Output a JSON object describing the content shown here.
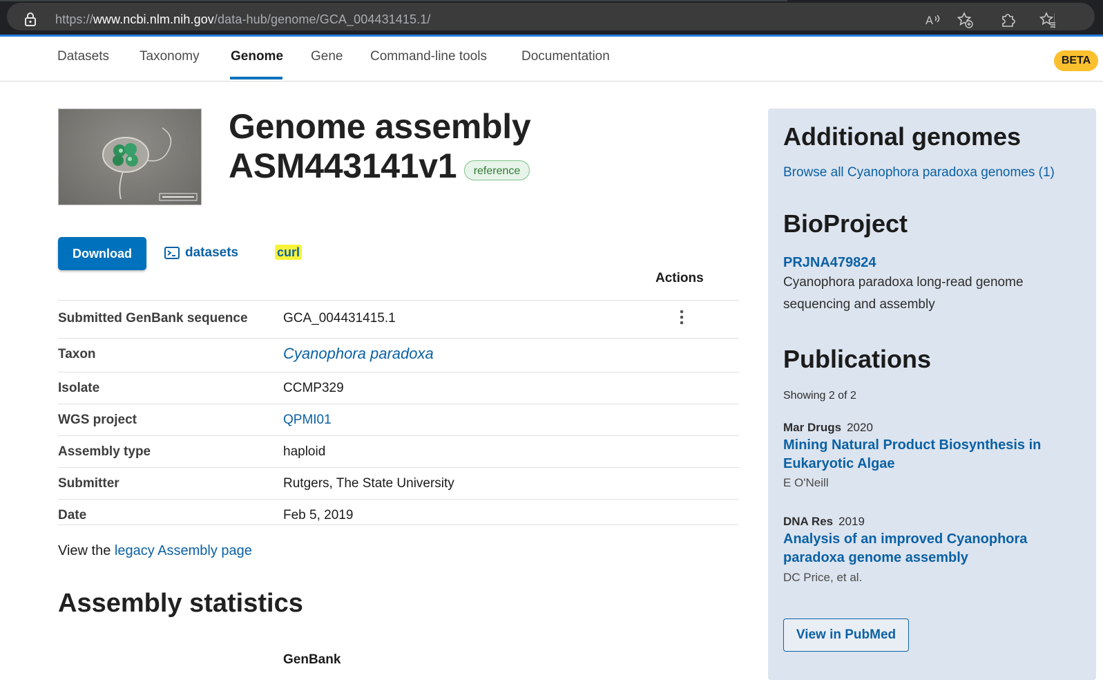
{
  "browser": {
    "url_prefix": "https://",
    "url_host": "www.ncbi.nlm.nih.gov",
    "url_path": "/data-hub/genome/GCA_004431415.1/",
    "icons": [
      "lock-icon",
      "read-aloud-icon",
      "favorite-add-icon",
      "extensions-icon",
      "favorites-icon"
    ]
  },
  "nav": {
    "items": [
      "Datasets",
      "Taxonomy",
      "Genome",
      "Gene",
      "Command-line tools",
      "Documentation"
    ],
    "active": "Genome",
    "beta": "BETA"
  },
  "header": {
    "title_line1": "Genome assembly",
    "title_line2": "ASM443141v1",
    "badge": "reference"
  },
  "actions": {
    "download": "Download",
    "datasets": "datasets",
    "curl": "curl",
    "actions_label": "Actions"
  },
  "details": [
    {
      "key": "Submitted GenBank sequence",
      "value": "GCA_004431415.1"
    },
    {
      "key": "Taxon",
      "value": "Cyanophora paradoxa"
    },
    {
      "key": "Isolate",
      "value": "CCMP329"
    },
    {
      "key": "WGS project",
      "value": "QPMI01"
    },
    {
      "key": "Assembly type",
      "value": "haploid"
    },
    {
      "key": "Submitter",
      "value": "Rutgers, The State University"
    },
    {
      "key": "Date",
      "value": "Feb 5, 2019"
    }
  ],
  "legacy": {
    "prefix": "View the ",
    "link": "legacy Assembly page"
  },
  "stats": {
    "title": "Assembly statistics",
    "column": "GenBank"
  },
  "sidebar": {
    "additional_title": "Additional genomes",
    "browse_link": "Browse all Cyanophora paradoxa genomes (1)",
    "bioproject_title": "BioProject",
    "bioproject_id": "PRJNA479824",
    "bioproject_desc": "Cyanophora paradoxa long-read genome sequencing and assembly",
    "publications_title": "Publications",
    "showing": "Showing 2 of 2",
    "publications": [
      {
        "journal": "Mar Drugs",
        "year": "2020",
        "title": "Mining Natural Product Biosynthesis in Eukaryotic Algae",
        "authors": "E O'Neill"
      },
      {
        "journal": "DNA Res",
        "year": "2019",
        "title": "Analysis of an improved Cyanophora paradoxa genome assembly",
        "authors": "DC Price, et al."
      }
    ],
    "pubmed_button": "View in PubMed"
  },
  "colors": {
    "accent": "#0071bc",
    "link": "#0b61a4",
    "sidebar_bg": "#dce4ef",
    "beta": "#fbc02d",
    "highlight": "#f6f33a"
  }
}
